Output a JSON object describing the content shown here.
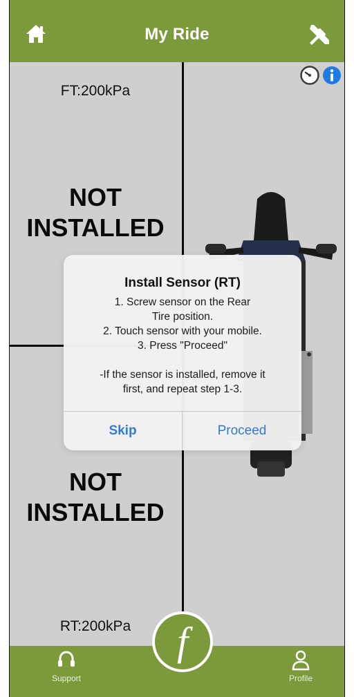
{
  "header": {
    "title": "My Ride",
    "home_icon": "home-icon",
    "tools_icon": "tools-icon"
  },
  "status_icons": {
    "gauge_icon": "gauge-icon",
    "info_icon": "info-icon"
  },
  "front": {
    "pressure_label": "FT:200kPa",
    "status_line1": "NOT",
    "status_line2": "INSTALLED"
  },
  "rear": {
    "pressure_label": "RT:200kPa",
    "status_line1": "NOT",
    "status_line2": "INSTALLED"
  },
  "dialog": {
    "title": "Install Sensor (RT)",
    "message": "1. Screw sensor on the Rear\nTire position.\n2. Touch sensor with your mobile.\n3. Press \"Proceed\"\n\n-If the sensor is installed, remove it\nfirst, and repeat step 1-3.",
    "skip_label": "Skip",
    "proceed_label": "Proceed"
  },
  "tabbar": {
    "support_label": "Support",
    "profile_label": "Profile",
    "center_logo": "f"
  },
  "colors": {
    "brand_green": "#7c9a3b",
    "background": "#cfcfcf",
    "dialog_accent": "#2f7bd5",
    "info_blue": "#1e7be0"
  }
}
